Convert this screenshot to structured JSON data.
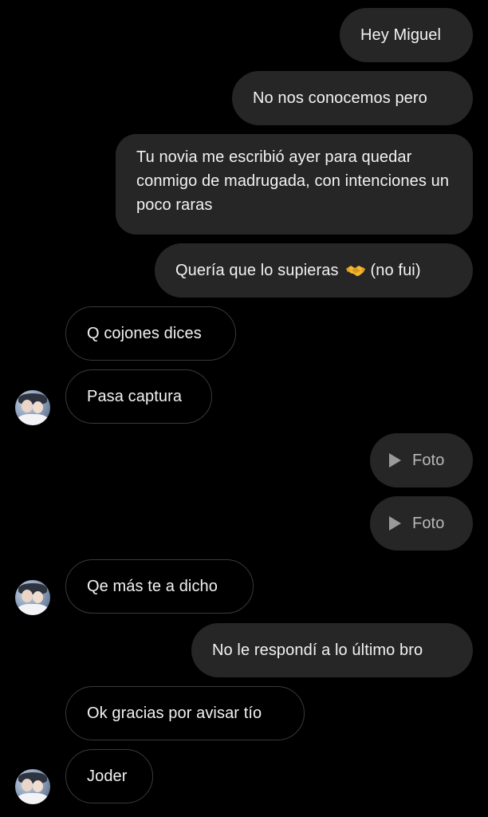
{
  "conversation": {
    "messages": [
      {
        "from": "me",
        "text": "Hey Miguel"
      },
      {
        "from": "me",
        "text": "No nos conocemos pero"
      },
      {
        "from": "me",
        "text": "Tu novia me escribió ayer para quedar conmigo de madrugada, con intenciones un poco raras"
      },
      {
        "from": "me",
        "text_before": "Quería que lo supieras",
        "emoji": "handshake-icon",
        "text_after": "(no fui)"
      },
      {
        "from": "them",
        "text": "Q cojones dices"
      },
      {
        "from": "them",
        "text": "Pasa captura"
      },
      {
        "from": "me",
        "type": "photo",
        "text": "Foto"
      },
      {
        "from": "me",
        "type": "photo",
        "text": "Foto"
      },
      {
        "from": "them",
        "text": "Qe más te a dicho"
      },
      {
        "from": "me",
        "text": "No le respondí a lo último bro"
      },
      {
        "from": "them",
        "text": "Ok gracias por avisar tío"
      },
      {
        "from": "them",
        "text": "Joder"
      }
    ]
  },
  "colors": {
    "background": "#000000",
    "sent_bubble": "#262626",
    "received_border": "#3a3a3a",
    "text": "#f2f2f2"
  }
}
